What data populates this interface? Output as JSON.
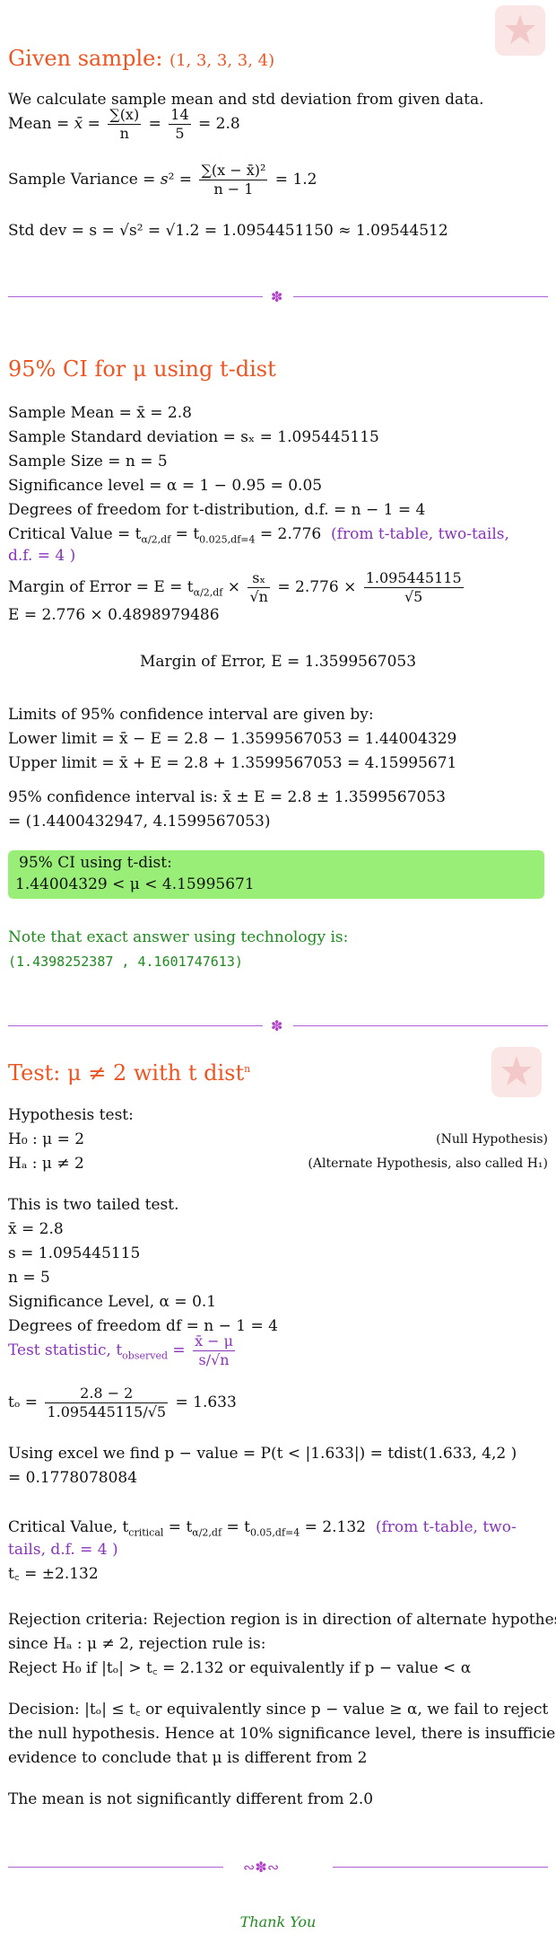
{
  "sections": {
    "given": {
      "title": "Given sample:",
      "sample": "(1, 3, 3, 3, 4)",
      "intro": "We calculate sample mean and std deviation from given data.",
      "mean_label": "Mean =",
      "mean_sum": "∑(x)",
      "mean_n": "n",
      "mean_num": "14",
      "mean_den": "5",
      "mean_value": "= 2.8",
      "var_label": "Sample Variance =",
      "var_num": "∑(x − x̄)²",
      "var_den": "n − 1",
      "var_value": "= 1.2",
      "std_line": "Std dev = s = √s² = √1.2 = 1.0954451150 ≈ 1.09544512"
    },
    "ci": {
      "title": "95% CI for μ using t-dist",
      "mean": "Sample Mean = x̄ = 2.8",
      "sd": "Sample Standard deviation = sₓ = 1.095445115",
      "size": "Sample Size = n = 5",
      "sig": "Significance level = α = 1 − 0.95 = 0.05",
      "df": "Degrees of freedom for t-distribution, d.f. = n − 1 = 4",
      "crit": "Critical Value = t",
      "crit_sub1": "α/2,df",
      "crit_mid": " = t",
      "crit_sub2": "0.025,df=4",
      "crit_val": " = 2.776",
      "crit_note1": "(from t-table, two-tails,",
      "crit_note2": "d.f. = 4 )",
      "moe_label": "Margin of Error = E = t",
      "moe_sub": "α/2,df",
      "moe_times": "×",
      "moe_num1": "sₓ",
      "moe_den1": "√n",
      "moe_eq": "= 2.776 ×",
      "moe_num2": "1.095445115",
      "moe_den2": "√5",
      "moe_calc": "E = 2.776 × 0.4898979486",
      "moe_result": "Margin of Error, E = 1.3599567053",
      "limits_intro": "Limits of 95% confidence interval are given by:",
      "lower": "Lower limit = x̄ − E = 2.8 − 1.3599567053 = 1.44004329",
      "upper": "Upper limit = x̄ + E = 2.8 + 1.3599567053 = 4.15995671",
      "interval1": "95% confidence interval is: x̄ ± E = 2.8 ± 1.3599567053",
      "interval2": "= (1.4400432947, 4.1599567053)",
      "box_title": "95% CI using t-dist:",
      "box_value": "1.44004329 < μ < 4.15995671",
      "tech_note": "Note that exact answer using technology is:",
      "tech_value": "(1.4398252387 , 4.1601747613)"
    },
    "test": {
      "title": "Test: μ ≠ 2 with t dist",
      "title_sup": "n",
      "hyp_label": "Hypothesis test:",
      "h0": "H₀ : μ = 2",
      "h0_note": "(Null Hypothesis)",
      "ha": "Hₐ : μ ≠ 2",
      "ha_note": "(Alternate Hypothesis, also called H₁)",
      "two_tailed": "This is two tailed test.",
      "xbar": "x̄ = 2.8",
      "s": "s = 1.095445115",
      "n": "n = 5",
      "alpha": "Significance Level, α = 0.1",
      "df": "Degrees of freedom df = n − 1 = 4",
      "ts_label": "Test statistic, t",
      "ts_sub": "observed",
      "ts_eq": "=",
      "ts_num": "x̄ − μ",
      "ts_den": "s/√n",
      "to_label": "tₒ =",
      "to_num": "2.8 − 2",
      "to_den": "1.095445115/√5",
      "to_value": "= 1.633",
      "pval1": "Using excel we find p − value = P(t < |1.633|) = tdist(1.633, 4,2 )",
      "pval2": "= 0.1778078084",
      "crit1_a": "Critical Value, t",
      "crit1_sub1": "critical",
      "crit1_b": " = t",
      "crit1_sub2": "α/2,df",
      "crit1_c": " = t",
      "crit1_sub3": "0.05,df=4",
      "crit1_d": " = 2.132",
      "crit_note1": "(from t-table, two-",
      "crit_note2": "tails, d.f. = 4 )",
      "tc": "t꜀ = ±2.132",
      "rej1": "Rejection criteria: Rejection region is in direction of alternate hypothesis,",
      "rej2": "since Hₐ : μ ≠ 2, rejection rule is:",
      "rej3": "Reject H₀ if |tₒ| > t꜀ = 2.132 or equivalently if p − value < α",
      "dec1": "Decision: |tₒ| ≤ t꜀ or equivalently since p − value ≥ α, we fail to reject",
      "dec2": "the null hypothesis. Hence at 10% significance level, there is insufficient",
      "dec3": "evidence to conclude that μ is different from 2",
      "conclusion": "The mean is not significantly different from 2.0"
    },
    "footer": {
      "divider_glyph": "✽",
      "ornament": "∾✽∾",
      "thanks": "Thank You"
    }
  },
  "colors": {
    "heading": "#ee5522",
    "note_purple": "#8833bb",
    "note_green": "#1f8a1f",
    "divider": "#b060d8",
    "result_box": "#99ee77"
  }
}
